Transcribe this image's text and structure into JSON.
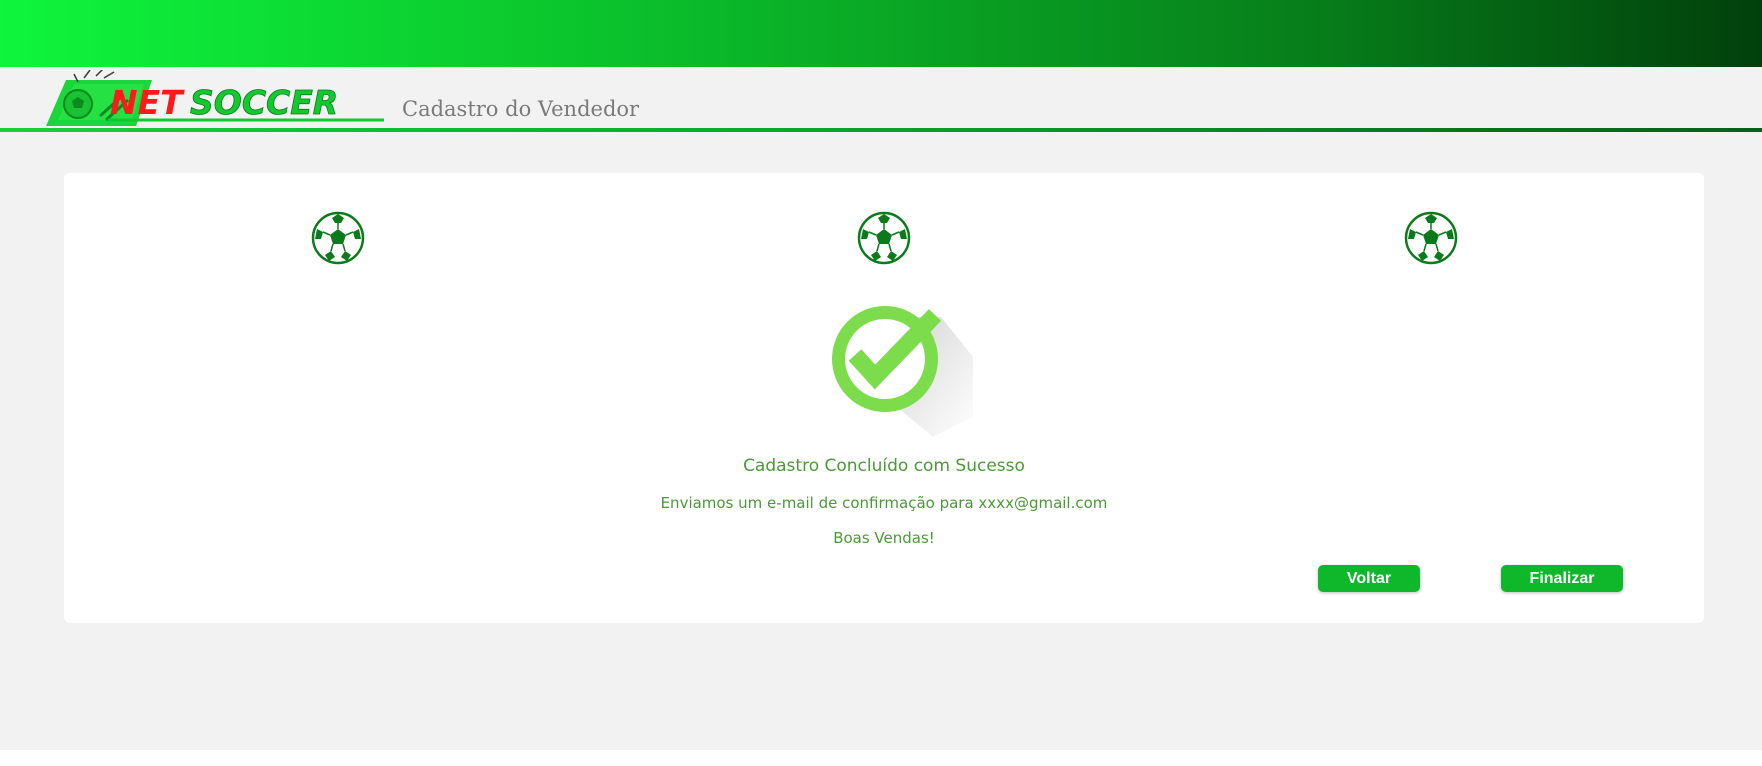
{
  "brand": {
    "logo_text_net": "NET",
    "logo_text_soccer": "SOCCER",
    "page_title": "Cadastro do Vendedor"
  },
  "steps": [
    {
      "icon": "soccer-ball-icon"
    },
    {
      "icon": "soccer-ball-icon"
    },
    {
      "icon": "soccer-ball-icon"
    }
  ],
  "result": {
    "icon": "success-check-icon",
    "title": "Cadastro Concluído com Sucesso",
    "email_message": "Enviamos um e-mail de confirmação para xxxx@gmail.com",
    "farewell": "Boas Vendas!"
  },
  "actions": {
    "back_label": "Voltar",
    "finish_label": "Finalizar"
  },
  "colors": {
    "accent_green": "#0fb82b",
    "message_green": "#4a9a35",
    "logo_red": "#ff1a1a",
    "check_green": "#7ddc4c"
  }
}
